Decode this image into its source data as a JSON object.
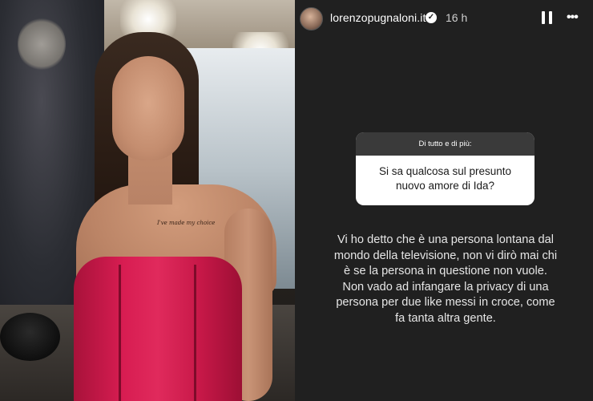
{
  "photo": {
    "tattoo_text": "I've made my choice"
  },
  "story": {
    "username": "lorenzopugnaloni.it",
    "verified_glyph": "✓",
    "time_ago": "16 h",
    "more_label": "•••",
    "question_box": {
      "header": "Di tutto e di più:",
      "question": "Si sa qualcosa sul presunto nuovo amore di Ida?"
    },
    "answer_lines": [
      "Vi ho detto che è una persona lontana dal",
      "mondo della televisione, non vi dirò mai chi",
      "è se la persona in questione non vuole.",
      "Non vado ad infangare la privacy di una",
      "persona per due like messi in croce, come",
      "fa tanta altra gente."
    ]
  }
}
